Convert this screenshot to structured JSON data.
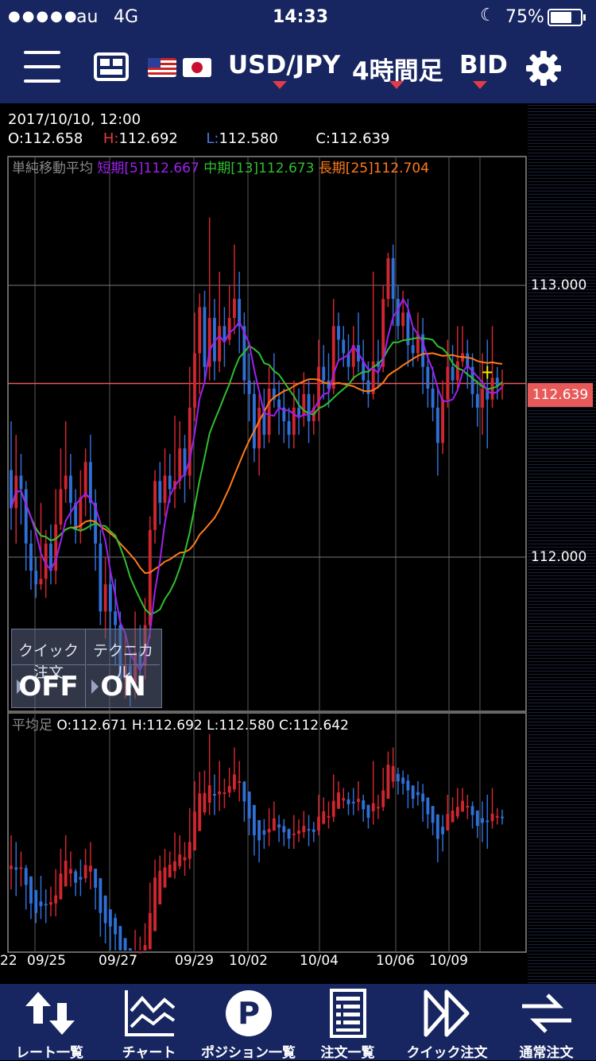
{
  "status_bar": {
    "signal_dots": "●●●●●",
    "carrier": "au",
    "network": "4G",
    "time": "14:33",
    "moon": "☾",
    "battery": "75%",
    "battery_level": 0.75
  },
  "toolbar": {
    "pair": "USD/JPY",
    "timeframe": "4時間足",
    "side": "BID"
  },
  "ohlc_header": {
    "datetime": "2017/10/10, 12:00",
    "o_label": "O:",
    "o_value": "112.658",
    "h_label": "H:",
    "h_value": "112.692",
    "l_label": "L:",
    "l_value": "112.580",
    "c_label": "C:",
    "c_value": "112.639"
  },
  "legend": {
    "title": "単純移動平均",
    "short": "短期[5]112.667",
    "mid": "中期[13]112.673",
    "long": "長期[25]112.704"
  },
  "price_axis": {
    "upper": "113.000",
    "lower": "112.000",
    "current": "112.639"
  },
  "quick_panel": {
    "quick_order_title": "クイック注文",
    "quick_order_value": "OFF",
    "technical_title": "テクニカル",
    "technical_value": "ON"
  },
  "sub_chart": {
    "title": "平均足",
    "values": "O:112.671 H:112.692 L:112.580 C:112.642"
  },
  "date_axis": [
    "22",
    "09/25",
    "09/27",
    "09/29",
    "10/02",
    "10/04",
    "10/06",
    "10/09"
  ],
  "bottom_tabs": [
    {
      "label": "レート一覧",
      "icon": "updown-arrows-icon"
    },
    {
      "label": "チャート",
      "icon": "chart-icon"
    },
    {
      "label": "ポジション一覧",
      "icon": "position-icon"
    },
    {
      "label": "注文一覧",
      "icon": "order-list-icon"
    },
    {
      "label": "クイック注文",
      "icon": "quick-order-icon"
    },
    {
      "label": "通常注文",
      "icon": "normal-order-icon"
    }
  ],
  "colors": {
    "bar_bg": "#172560",
    "up_candle": "#d0262f",
    "down_candle": "#2f6fd6",
    "sma_short": "#a020f0",
    "sma_mid": "#2fbf2f",
    "sma_long": "#ff7a1a",
    "current_price": "#e85a5a",
    "accent": "#e23b4b"
  },
  "chart_data": {
    "type": "candlestick",
    "y_ticks": [
      112.0,
      113.0
    ],
    "current_price": 112.639,
    "series": [
      {
        "name": "短期[5]",
        "last": 112.667
      },
      {
        "name": "中期[13]",
        "last": 112.673
      },
      {
        "name": "長期[25]",
        "last": 112.704
      }
    ],
    "x_ticks": [
      "22",
      "09/25",
      "09/27",
      "09/29",
      "10/02",
      "10/04",
      "10/06",
      "10/09"
    ],
    "candles": [
      [
        112.32,
        112.18,
        112.5,
        112.1
      ],
      [
        112.18,
        112.3,
        112.45,
        112.05
      ],
      [
        112.3,
        112.25,
        112.38,
        112.12
      ],
      [
        112.25,
        112.05,
        112.28,
        111.95
      ],
      [
        112.05,
        111.95,
        112.1,
        111.88
      ],
      [
        111.95,
        111.9,
        112.0,
        111.85
      ],
      [
        111.9,
        111.92,
        112.2,
        111.88
      ],
      [
        111.92,
        112.05,
        112.1,
        111.85
      ],
      [
        112.05,
        111.95,
        112.12,
        111.9
      ],
      [
        111.95,
        112.12,
        112.25,
        111.9
      ],
      [
        112.12,
        112.25,
        112.4,
        112.1
      ],
      [
        112.25,
        112.3,
        112.5,
        112.2
      ],
      [
        112.3,
        112.2,
        112.38,
        112.12
      ],
      [
        112.2,
        112.1,
        112.25,
        112.05
      ],
      [
        112.1,
        112.22,
        112.32,
        112.05
      ],
      [
        112.22,
        112.35,
        112.4,
        112.15
      ],
      [
        112.35,
        112.2,
        112.45,
        112.1
      ],
      [
        112.2,
        112.05,
        112.25,
        111.95
      ],
      [
        112.05,
        111.8,
        112.1,
        111.75
      ],
      [
        111.8,
        111.9,
        112.0,
        111.7
      ],
      [
        111.9,
        111.8,
        111.95,
        111.65
      ],
      [
        111.8,
        111.75,
        111.92,
        111.6
      ],
      [
        111.75,
        111.55,
        111.8,
        111.5
      ],
      [
        111.55,
        111.6,
        111.72,
        111.48
      ],
      [
        111.6,
        111.52,
        111.65,
        111.45
      ],
      [
        111.52,
        111.65,
        111.8,
        111.48
      ],
      [
        111.65,
        111.6,
        111.75,
        111.55
      ],
      [
        111.6,
        111.75,
        111.85,
        111.55
      ],
      [
        111.75,
        112.1,
        112.15,
        111.7
      ],
      [
        112.1,
        112.28,
        112.32,
        112.05
      ],
      [
        112.28,
        112.2,
        112.35,
        112.12
      ],
      [
        112.2,
        112.3,
        112.4,
        112.15
      ],
      [
        112.3,
        112.25,
        112.38,
        112.2
      ],
      [
        112.25,
        112.28,
        112.52,
        112.18
      ],
      [
        112.28,
        112.4,
        112.5,
        112.25
      ],
      [
        112.4,
        112.3,
        112.45,
        112.2
      ],
      [
        112.3,
        112.55,
        112.7,
        112.25
      ],
      [
        112.55,
        112.75,
        112.9,
        112.5
      ],
      [
        112.75,
        112.92,
        112.97,
        112.6
      ],
      [
        112.92,
        112.7,
        112.98,
        112.65
      ],
      [
        112.7,
        112.88,
        113.25,
        112.65
      ],
      [
        112.88,
        112.72,
        112.95,
        112.65
      ],
      [
        112.72,
        112.85,
        113.05,
        112.68
      ],
      [
        112.85,
        112.8,
        112.92,
        112.7
      ],
      [
        112.8,
        112.88,
        113.0,
        112.78
      ],
      [
        112.88,
        112.95,
        113.15,
        112.82
      ],
      [
        112.95,
        112.85,
        113.05,
        112.75
      ],
      [
        112.85,
        112.65,
        112.9,
        112.6
      ],
      [
        112.65,
        112.6,
        112.75,
        112.5
      ],
      [
        112.6,
        112.4,
        112.65,
        112.35
      ],
      [
        112.4,
        112.55,
        112.6,
        112.3
      ],
      [
        112.55,
        112.45,
        112.62,
        112.4
      ],
      [
        112.45,
        112.62,
        112.7,
        112.42
      ],
      [
        112.62,
        112.58,
        112.75,
        112.55
      ],
      [
        112.58,
        112.55,
        112.65,
        112.45
      ],
      [
        112.55,
        112.5,
        112.62,
        112.42
      ],
      [
        112.5,
        112.45,
        112.55,
        112.4
      ],
      [
        112.45,
        112.55,
        112.65,
        112.4
      ],
      [
        112.55,
        112.52,
        112.62,
        112.45
      ],
      [
        112.52,
        112.6,
        112.68,
        112.48
      ],
      [
        112.6,
        112.5,
        112.65,
        112.42
      ],
      [
        112.5,
        112.55,
        112.6,
        112.45
      ],
      [
        112.55,
        112.7,
        112.8,
        112.5
      ],
      [
        112.7,
        112.65,
        112.78,
        112.58
      ],
      [
        112.65,
        112.62,
        112.75,
        112.55
      ],
      [
        112.62,
        112.85,
        112.95,
        112.6
      ],
      [
        112.85,
        112.8,
        112.9,
        112.72
      ],
      [
        112.8,
        112.75,
        112.85,
        112.7
      ],
      [
        112.75,
        112.7,
        112.82,
        112.65
      ],
      [
        112.7,
        112.78,
        112.85,
        112.65
      ],
      [
        112.78,
        112.72,
        112.9,
        112.68
      ],
      [
        112.72,
        112.65,
        112.8,
        112.6
      ],
      [
        112.65,
        112.6,
        112.72,
        112.55
      ],
      [
        112.6,
        112.72,
        113.05,
        112.58
      ],
      [
        112.72,
        112.7,
        112.8,
        112.62
      ],
      [
        112.7,
        112.95,
        113.0,
        112.68
      ],
      [
        112.95,
        113.1,
        113.12,
        112.92
      ],
      [
        113.1,
        112.95,
        113.15,
        112.85
      ],
      [
        112.95,
        112.85,
        113.0,
        112.8
      ],
      [
        112.85,
        112.9,
        112.98,
        112.8
      ],
      [
        112.9,
        112.78,
        112.95,
        112.7
      ],
      [
        112.78,
        112.75,
        112.85,
        112.7
      ],
      [
        112.75,
        112.82,
        112.9,
        112.72
      ],
      [
        112.82,
        112.7,
        112.88,
        112.6
      ],
      [
        112.7,
        112.62,
        112.75,
        112.55
      ],
      [
        112.62,
        112.55,
        112.7,
        112.5
      ],
      [
        112.55,
        112.42,
        112.62,
        112.3
      ],
      [
        112.42,
        112.58,
        112.65,
        112.38
      ],
      [
        112.58,
        112.7,
        112.8,
        112.55
      ],
      [
        112.7,
        112.65,
        112.78,
        112.6
      ],
      [
        112.65,
        112.72,
        112.85,
        112.62
      ],
      [
        112.72,
        112.75,
        112.85,
        112.7
      ],
      [
        112.75,
        112.7,
        112.8,
        112.62
      ],
      [
        112.7,
        112.6,
        112.75,
        112.55
      ],
      [
        112.6,
        112.55,
        112.65,
        112.48
      ],
      [
        112.55,
        112.62,
        112.75,
        112.45
      ],
      [
        112.62,
        112.58,
        112.8,
        112.4
      ],
      [
        112.58,
        112.66,
        112.85,
        112.55
      ],
      [
        112.66,
        112.63,
        112.7,
        112.58
      ],
      [
        112.63,
        112.64,
        112.69,
        112.58
      ]
    ]
  }
}
